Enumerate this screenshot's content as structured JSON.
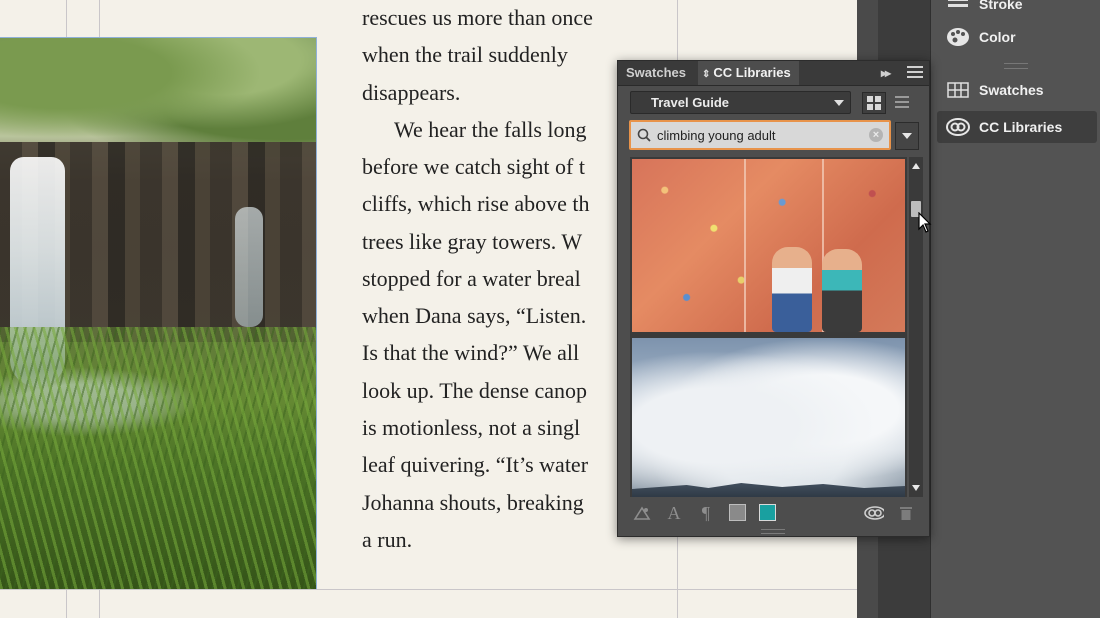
{
  "body_text": [
    "rescues us more than once",
    "when the trail suddenly",
    "disappears.",
    "We hear the falls long",
    "before we catch sight of t",
    "cliffs, which rise above th",
    "trees like gray towers. W",
    "stopped for a water breal",
    "when Dana says, “Listen.",
    "Is that the wind?” We all",
    "look up. The dense canop",
    "is motionless, not a singl",
    "leaf quivering. “It’s water",
    "Johanna shouts, breaking",
    "a run."
  ],
  "side_panel": {
    "items": [
      {
        "label": "Stroke",
        "icon": "stroke-icon"
      },
      {
        "label": "Color",
        "icon": "color-palette-icon"
      },
      {
        "label": "Swatches",
        "icon": "swatches-grid-icon"
      },
      {
        "label": "CC Libraries",
        "icon": "cc-libraries-icon",
        "active": true
      }
    ]
  },
  "library_panel": {
    "tabs": [
      {
        "label": "Swatches",
        "active": false
      },
      {
        "label": "CC Libraries",
        "active": true,
        "icon": "updown-arrows-icon"
      }
    ],
    "collapse_glyph": "▸▸",
    "library_selected": "Travel Guide",
    "search": {
      "value": "climbing young adult",
      "clear_glyph": "×"
    },
    "results": [
      {
        "name": "climbing-wall-photo",
        "kind": "image"
      },
      {
        "name": "cloudy-sky-photo",
        "kind": "image"
      }
    ],
    "footer_icons": [
      "graphic-icon",
      "character-style-icon",
      "paragraph-style-icon",
      "color-swatch-gray",
      "color-swatch-teal",
      "cc-sync-icon",
      "trash-icon"
    ],
    "footer_glyphs": {
      "character_style": "A",
      "paragraph_style": "¶"
    },
    "colors": {
      "teal_swatch": "#19a0a0",
      "gray_swatch": "#8a8a8a",
      "search_focus": "#e8934a"
    }
  }
}
